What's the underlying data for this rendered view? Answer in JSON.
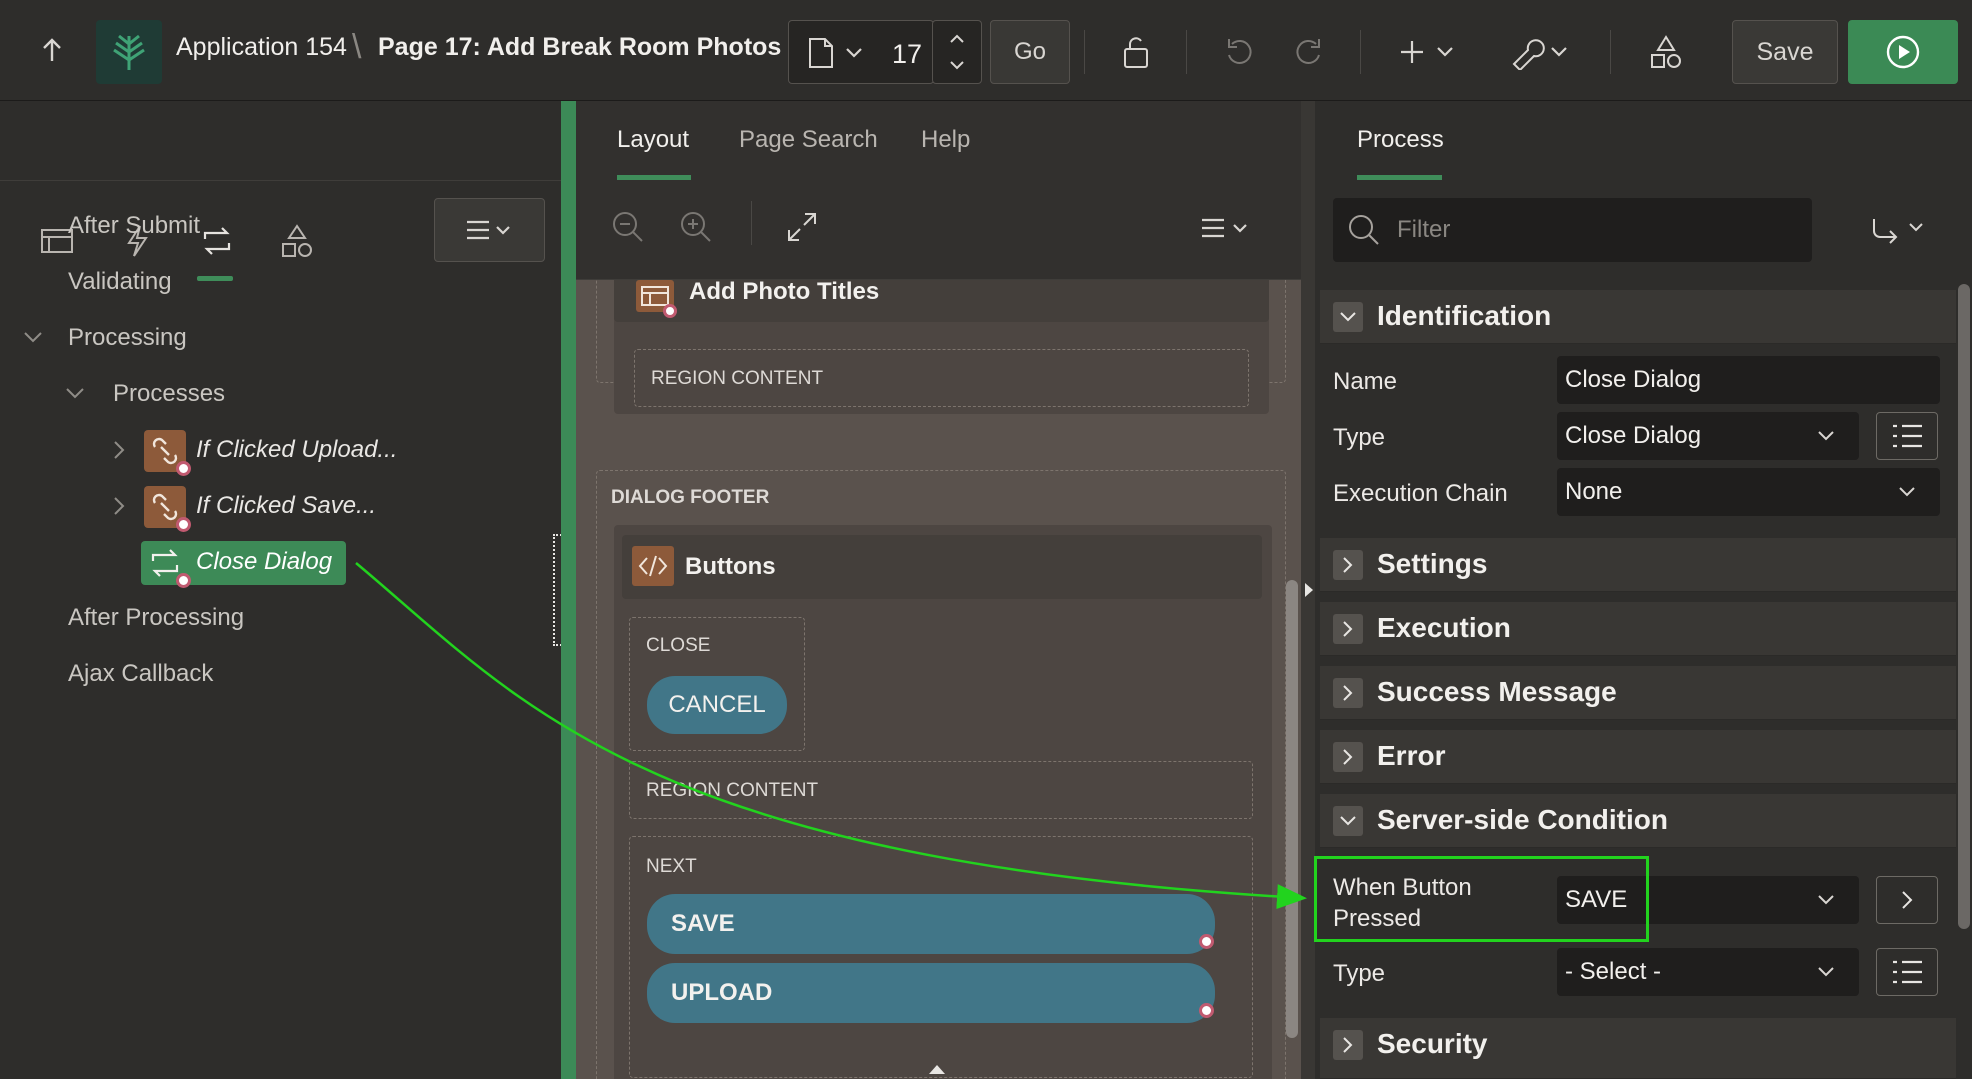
{
  "topbar": {
    "app_title": "Application 154",
    "breadcrumb_sep": "\\",
    "page_title": "Page 17: Add Break Room Photos",
    "page_number": "17",
    "go_label": "Go",
    "save_label": "Save"
  },
  "left": {
    "tree": {
      "after_submit": "After Submit",
      "validating": "Validating",
      "processing": "Processing",
      "processes": "Processes",
      "if_clicked_upload": "If Clicked Upload...",
      "if_clicked_save": "If Clicked Save...",
      "close_dialog": "Close Dialog",
      "after_processing": "After Processing",
      "ajax_callback": "Ajax Callback"
    }
  },
  "center": {
    "tabs": {
      "layout": "Layout",
      "page_search": "Page Search",
      "help": "Help"
    },
    "canvas": {
      "add_photo_titles": "Add Photo Titles",
      "region_content_1": "REGION CONTENT",
      "dialog_footer": "DIALOG FOOTER",
      "buttons_region": "Buttons",
      "close_slot": "CLOSE",
      "cancel_button": "CANCEL",
      "region_content_2": "REGION CONTENT",
      "next_slot": "NEXT",
      "save_button": "SAVE",
      "upload_button": "UPLOAD"
    }
  },
  "right": {
    "tab": "Process",
    "filter_placeholder": "Filter",
    "sections": {
      "identification": "Identification",
      "settings": "Settings",
      "execution": "Execution",
      "success_message": "Success Message",
      "error": "Error",
      "server_side_condition": "Server-side Condition",
      "security": "Security"
    },
    "props": {
      "name_label": "Name",
      "name_value": "Close Dialog",
      "type_label": "Type",
      "type_value": "Close Dialog",
      "exec_chain_label": "Execution Chain",
      "exec_chain_value": "None",
      "when_button_label_1": "When Button",
      "when_button_label_2": "Pressed",
      "when_button_value": "SAVE",
      "cond_type_label": "Type",
      "cond_type_value": "- Select -"
    }
  },
  "colors": {
    "accent_green": "#3f8d5a",
    "annotation_green": "#22d31e",
    "button_teal": "#417688",
    "process_icon_brown": "#8d5a3a"
  }
}
